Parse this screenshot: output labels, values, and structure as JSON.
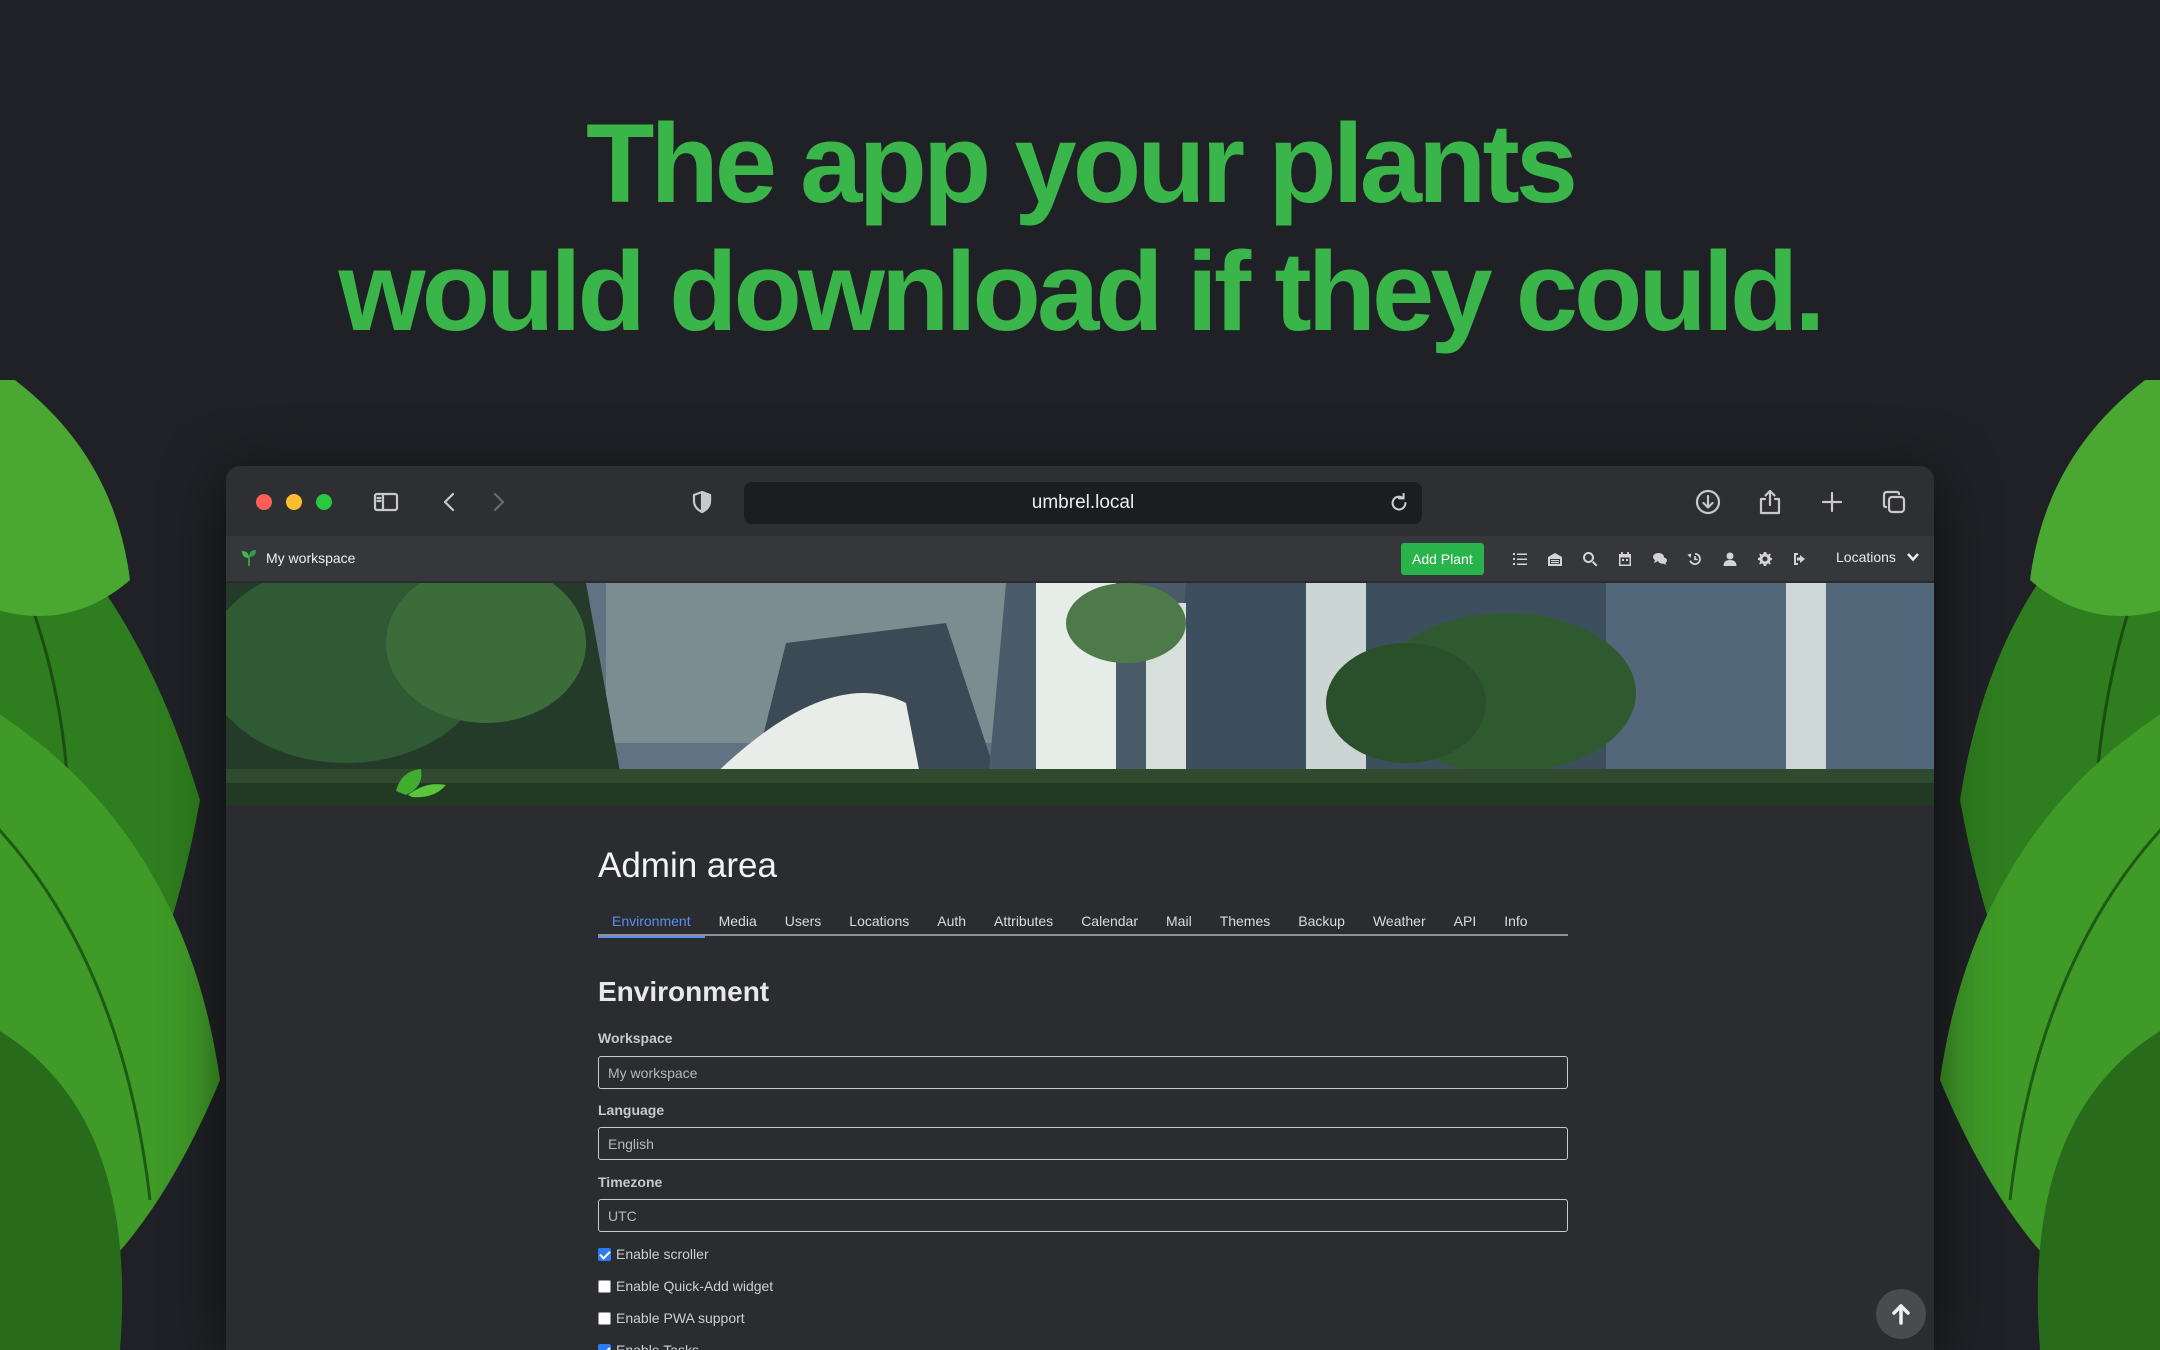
{
  "headline": {
    "line1": "The app your plants",
    "line2": "would download if they could."
  },
  "browser": {
    "url": "umbrel.local"
  },
  "app_nav": {
    "workspace_name": "My workspace",
    "add_plant_label": "Add Plant",
    "icons": [
      "list-icon",
      "inventory-icon",
      "search-icon",
      "calendar-icon",
      "chat-icon",
      "history-icon",
      "user-icon",
      "settings-icon",
      "logout-icon"
    ],
    "locations_label": "Locations"
  },
  "admin": {
    "title": "Admin area",
    "tabs": [
      {
        "label": "Environment",
        "active": true
      },
      {
        "label": "Media"
      },
      {
        "label": "Users"
      },
      {
        "label": "Locations"
      },
      {
        "label": "Auth"
      },
      {
        "label": "Attributes"
      },
      {
        "label": "Calendar"
      },
      {
        "label": "Mail"
      },
      {
        "label": "Themes"
      },
      {
        "label": "Backup"
      },
      {
        "label": "Weather"
      },
      {
        "label": "API"
      },
      {
        "label": "Info"
      }
    ],
    "section_title": "Environment",
    "fields": {
      "workspace": {
        "label": "Workspace",
        "value": "My workspace"
      },
      "language": {
        "label": "Language",
        "value": "English"
      },
      "timezone": {
        "label": "Timezone",
        "value": "UTC"
      }
    },
    "checkboxes": [
      {
        "label": "Enable scroller",
        "checked": true
      },
      {
        "label": "Enable Quick-Add widget",
        "checked": false
      },
      {
        "label": "Enable PWA support",
        "checked": false
      },
      {
        "label": "Enable Tasks",
        "checked": true
      }
    ]
  },
  "colors": {
    "headline_green": "#39b54a",
    "add_plant_green": "#28b44a",
    "active_tab_blue": "#5b8def",
    "checkbox_blue": "#2d7bf0"
  }
}
